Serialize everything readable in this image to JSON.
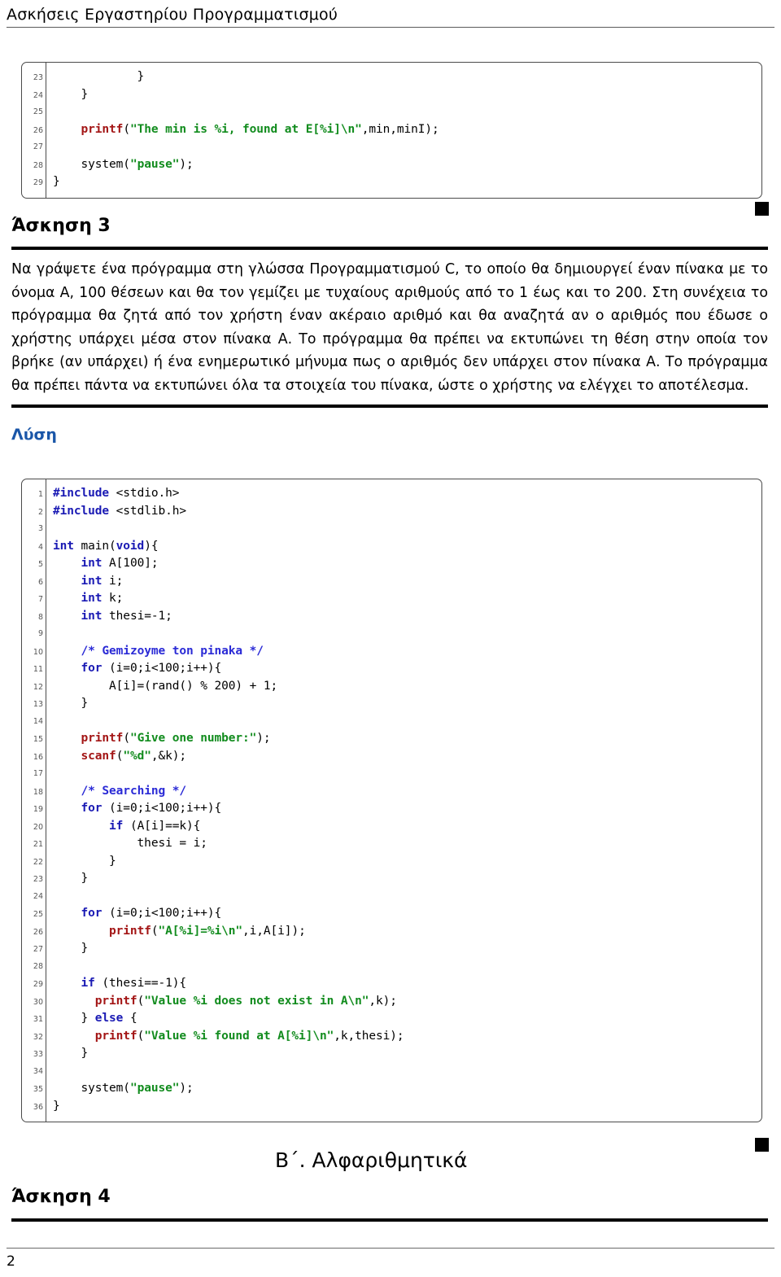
{
  "header": {
    "title": "Ασκήσεις Εργαστηρίου Προγραμματισμού"
  },
  "code_block_top": {
    "lines": [
      {
        "no": "23",
        "segments": [
          {
            "t": "            }",
            "c": "plain"
          }
        ]
      },
      {
        "no": "24",
        "segments": [
          {
            "t": "    }",
            "c": "plain"
          }
        ]
      },
      {
        "no": "25",
        "segments": [
          {
            "t": "",
            "c": "plain"
          }
        ]
      },
      {
        "no": "26",
        "segments": [
          {
            "t": "    ",
            "c": "plain"
          },
          {
            "t": "printf",
            "c": "fn"
          },
          {
            "t": "(",
            "c": "plain"
          },
          {
            "t": "\"The min is %i, found at E[%i]\\n\"",
            "c": "str"
          },
          {
            "t": ",min,minI);",
            "c": "plain"
          }
        ]
      },
      {
        "no": "27",
        "segments": [
          {
            "t": "",
            "c": "plain"
          }
        ]
      },
      {
        "no": "28",
        "segments": [
          {
            "t": "    system(",
            "c": "plain"
          },
          {
            "t": "\"pause\"",
            "c": "str"
          },
          {
            "t": ");",
            "c": "plain"
          }
        ]
      },
      {
        "no": "29",
        "segments": [
          {
            "t": "}",
            "c": "plain"
          }
        ]
      }
    ]
  },
  "exercise3": {
    "heading": "Άσκηση 3",
    "paragraph": "Να γράψετε ένα πρόγραμμα στη γλώσσα Προγραμματισμού C, το οποίο θα δημιουργεί έναν πίνακα με το όνομα Α, 100 θέσεων και θα τον γεμίζει με τυχαίους αριθμούς από το 1 έως και το 200. Στη συνέχεια το πρόγραμμα θα ζητά από τον χρήστη έναν ακέραιο αριθμό και θα αναζητά αν ο αριθμός που έδωσε ο χρήστης υπάρχει μέσα στον πίνακα Α. Το πρόγραμμα θα πρέπει να εκτυπώνει τη θέση στην οποία τον βρήκε (αν υπάρχει) ή ένα ενημερωτικό μήνυμα πως ο αριθμός δεν υπάρχει στον πίνακα Α. Το πρόγραμμα θα πρέπει πάντα να εκτυπώνει όλα τα στοιχεία του πίνακα, ώστε ο χρήστης να ελέγχει το αποτέλεσμα.",
    "solution_label": "Λύση"
  },
  "code_block_main": {
    "lines": [
      {
        "no": "1",
        "segments": [
          {
            "t": "#include",
            "c": "pp"
          },
          {
            "t": " <stdio.h>",
            "c": "plain"
          }
        ]
      },
      {
        "no": "2",
        "segments": [
          {
            "t": "#include",
            "c": "pp"
          },
          {
            "t": " <stdlib.h>",
            "c": "plain"
          }
        ]
      },
      {
        "no": "3",
        "segments": [
          {
            "t": "",
            "c": "plain"
          }
        ]
      },
      {
        "no": "4",
        "segments": [
          {
            "t": "int",
            "c": "kw"
          },
          {
            "t": " main(",
            "c": "plain"
          },
          {
            "t": "void",
            "c": "kw"
          },
          {
            "t": "){",
            "c": "plain"
          }
        ]
      },
      {
        "no": "5",
        "segments": [
          {
            "t": "    ",
            "c": "plain"
          },
          {
            "t": "int",
            "c": "kw"
          },
          {
            "t": " A[100];",
            "c": "plain"
          }
        ]
      },
      {
        "no": "6",
        "segments": [
          {
            "t": "    ",
            "c": "plain"
          },
          {
            "t": "int",
            "c": "kw"
          },
          {
            "t": " i;",
            "c": "plain"
          }
        ]
      },
      {
        "no": "7",
        "segments": [
          {
            "t": "    ",
            "c": "plain"
          },
          {
            "t": "int",
            "c": "kw"
          },
          {
            "t": " k;",
            "c": "plain"
          }
        ]
      },
      {
        "no": "8",
        "segments": [
          {
            "t": "    ",
            "c": "plain"
          },
          {
            "t": "int",
            "c": "kw"
          },
          {
            "t": " thesi=-1;",
            "c": "plain"
          }
        ]
      },
      {
        "no": "9",
        "segments": [
          {
            "t": "",
            "c": "plain"
          }
        ]
      },
      {
        "no": "10",
        "segments": [
          {
            "t": "    ",
            "c": "plain"
          },
          {
            "t": "/* Gemizoyme ton pinaka */",
            "c": "cmt"
          }
        ]
      },
      {
        "no": "11",
        "segments": [
          {
            "t": "    ",
            "c": "plain"
          },
          {
            "t": "for",
            "c": "kw"
          },
          {
            "t": " (i=0;i<100;i++){",
            "c": "plain"
          }
        ]
      },
      {
        "no": "12",
        "segments": [
          {
            "t": "        A[i]=(rand() % 200) + 1;",
            "c": "plain"
          }
        ]
      },
      {
        "no": "13",
        "segments": [
          {
            "t": "    }",
            "c": "plain"
          }
        ]
      },
      {
        "no": "14",
        "segments": [
          {
            "t": "",
            "c": "plain"
          }
        ]
      },
      {
        "no": "15",
        "segments": [
          {
            "t": "    ",
            "c": "plain"
          },
          {
            "t": "printf",
            "c": "fn"
          },
          {
            "t": "(",
            "c": "plain"
          },
          {
            "t": "\"Give one number:\"",
            "c": "str"
          },
          {
            "t": ");",
            "c": "plain"
          }
        ]
      },
      {
        "no": "16",
        "segments": [
          {
            "t": "    ",
            "c": "plain"
          },
          {
            "t": "scanf",
            "c": "fn"
          },
          {
            "t": "(",
            "c": "plain"
          },
          {
            "t": "\"%d\"",
            "c": "str"
          },
          {
            "t": ",&k);",
            "c": "plain"
          }
        ]
      },
      {
        "no": "17",
        "segments": [
          {
            "t": "",
            "c": "plain"
          }
        ]
      },
      {
        "no": "18",
        "segments": [
          {
            "t": "    ",
            "c": "plain"
          },
          {
            "t": "/* Searching */",
            "c": "cmt"
          }
        ]
      },
      {
        "no": "19",
        "segments": [
          {
            "t": "    ",
            "c": "plain"
          },
          {
            "t": "for",
            "c": "kw"
          },
          {
            "t": " (i=0;i<100;i++){",
            "c": "plain"
          }
        ]
      },
      {
        "no": "20",
        "segments": [
          {
            "t": "        ",
            "c": "plain"
          },
          {
            "t": "if",
            "c": "kw"
          },
          {
            "t": " (A[i]==k){",
            "c": "plain"
          }
        ]
      },
      {
        "no": "21",
        "segments": [
          {
            "t": "            thesi = i;",
            "c": "plain"
          }
        ]
      },
      {
        "no": "22",
        "segments": [
          {
            "t": "        }",
            "c": "plain"
          }
        ]
      },
      {
        "no": "23",
        "segments": [
          {
            "t": "    }",
            "c": "plain"
          }
        ]
      },
      {
        "no": "24",
        "segments": [
          {
            "t": "",
            "c": "plain"
          }
        ]
      },
      {
        "no": "25",
        "segments": [
          {
            "t": "    ",
            "c": "plain"
          },
          {
            "t": "for",
            "c": "kw"
          },
          {
            "t": " (i=0;i<100;i++){",
            "c": "plain"
          }
        ]
      },
      {
        "no": "26",
        "segments": [
          {
            "t": "        ",
            "c": "plain"
          },
          {
            "t": "printf",
            "c": "fn"
          },
          {
            "t": "(",
            "c": "plain"
          },
          {
            "t": "\"A[%i]=%i\\n\"",
            "c": "str"
          },
          {
            "t": ",i,A[i]);",
            "c": "plain"
          }
        ]
      },
      {
        "no": "27",
        "segments": [
          {
            "t": "    }",
            "c": "plain"
          }
        ]
      },
      {
        "no": "28",
        "segments": [
          {
            "t": "",
            "c": "plain"
          }
        ]
      },
      {
        "no": "29",
        "segments": [
          {
            "t": "    ",
            "c": "plain"
          },
          {
            "t": "if",
            "c": "kw"
          },
          {
            "t": " (thesi==-1){",
            "c": "plain"
          }
        ]
      },
      {
        "no": "30",
        "segments": [
          {
            "t": "      ",
            "c": "plain"
          },
          {
            "t": "printf",
            "c": "fn"
          },
          {
            "t": "(",
            "c": "plain"
          },
          {
            "t": "\"Value %i does not exist in A\\n\"",
            "c": "str"
          },
          {
            "t": ",k);",
            "c": "plain"
          }
        ]
      },
      {
        "no": "31",
        "segments": [
          {
            "t": "    } ",
            "c": "plain"
          },
          {
            "t": "else",
            "c": "kw"
          },
          {
            "t": " {",
            "c": "plain"
          }
        ]
      },
      {
        "no": "32",
        "segments": [
          {
            "t": "      ",
            "c": "plain"
          },
          {
            "t": "printf",
            "c": "fn"
          },
          {
            "t": "(",
            "c": "plain"
          },
          {
            "t": "\"Value %i found at A[%i]\\n\"",
            "c": "str"
          },
          {
            "t": ",k,thesi);",
            "c": "plain"
          }
        ]
      },
      {
        "no": "33",
        "segments": [
          {
            "t": "    }",
            "c": "plain"
          }
        ]
      },
      {
        "no": "34",
        "segments": [
          {
            "t": "",
            "c": "plain"
          }
        ]
      },
      {
        "no": "35",
        "segments": [
          {
            "t": "    system(",
            "c": "plain"
          },
          {
            "t": "\"pause\"",
            "c": "str"
          },
          {
            "t": ");",
            "c": "plain"
          }
        ]
      },
      {
        "no": "36",
        "segments": [
          {
            "t": "}",
            "c": "plain"
          }
        ]
      }
    ]
  },
  "chapter": {
    "title": "Β΄. Αλφαριθμητικά"
  },
  "exercise4": {
    "heading": "Άσκηση 4"
  },
  "footer": {
    "page_number": "2"
  },
  "colors": {
    "keyword": "#1a1ab4",
    "function": "#a31515",
    "string": "#128c1e",
    "comment": "#2b2bd6",
    "heading_blue": "#1a56a8",
    "rule": "#000000"
  }
}
